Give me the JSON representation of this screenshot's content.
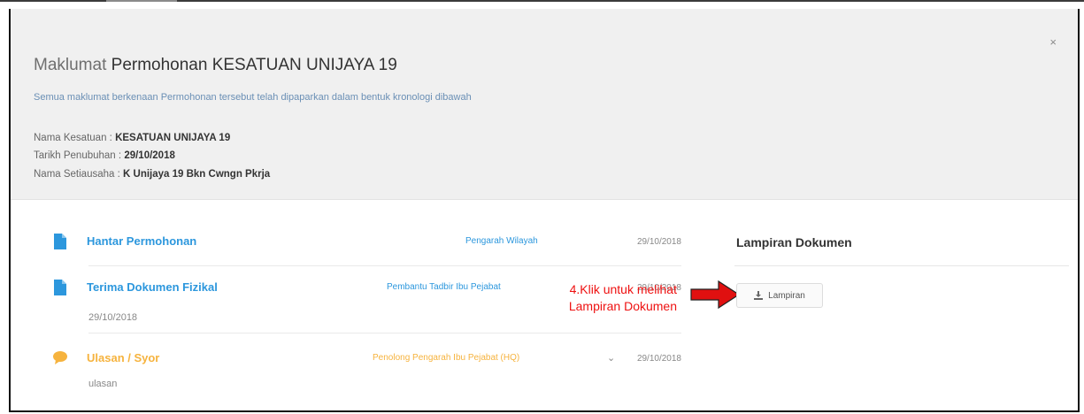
{
  "modal": {
    "close_symbol": "×",
    "title_prefix": "Maklumat",
    "title_main": "Permohonan KESATUAN UNIJAYA 19",
    "subtitle": "Semua maklumat berkenaan Permohonan tersebut telah dipaparkan dalam bentuk kronologi dibawah",
    "meta": [
      {
        "label": "Nama Kesatuan :",
        "value": "KESATUAN UNIJAYA 19"
      },
      {
        "label": "Tarikh Penubuhan :",
        "value": "29/10/2018"
      },
      {
        "label": "Nama Setiausaha :",
        "value": "K Unijaya 19 Bkn Cwngn Pkrja"
      }
    ]
  },
  "timeline": [
    {
      "title": "Hantar Permohonan",
      "who": "Pengarah Wilayah",
      "date": "29/10/2018",
      "icon": "document-icon",
      "color": "#2c97dd"
    },
    {
      "title": "Terima Dokumen Fizikal",
      "who": "Pembantu Tadbir Ibu Pejabat",
      "date": "29/10/2018",
      "sub": "29/10/2018",
      "icon": "document-icon",
      "color": "#2c97dd"
    },
    {
      "title": "Ulasan / Syor",
      "who": "Penolong Pengarah Ibu Pejabat (HQ)",
      "date": "29/10/2018",
      "sub": "ulasan",
      "chevron": "⌄",
      "icon": "comment-icon",
      "color": "#f6b33e"
    }
  ],
  "annotation": {
    "line1": "4.Klik untuk melihat",
    "line2": "Lampiran Dokumen",
    "color": "#e11111"
  },
  "sidebar": {
    "title": "Lampiran Dokumen",
    "button_label": "Lampiran",
    "button_icon": "download-icon"
  }
}
